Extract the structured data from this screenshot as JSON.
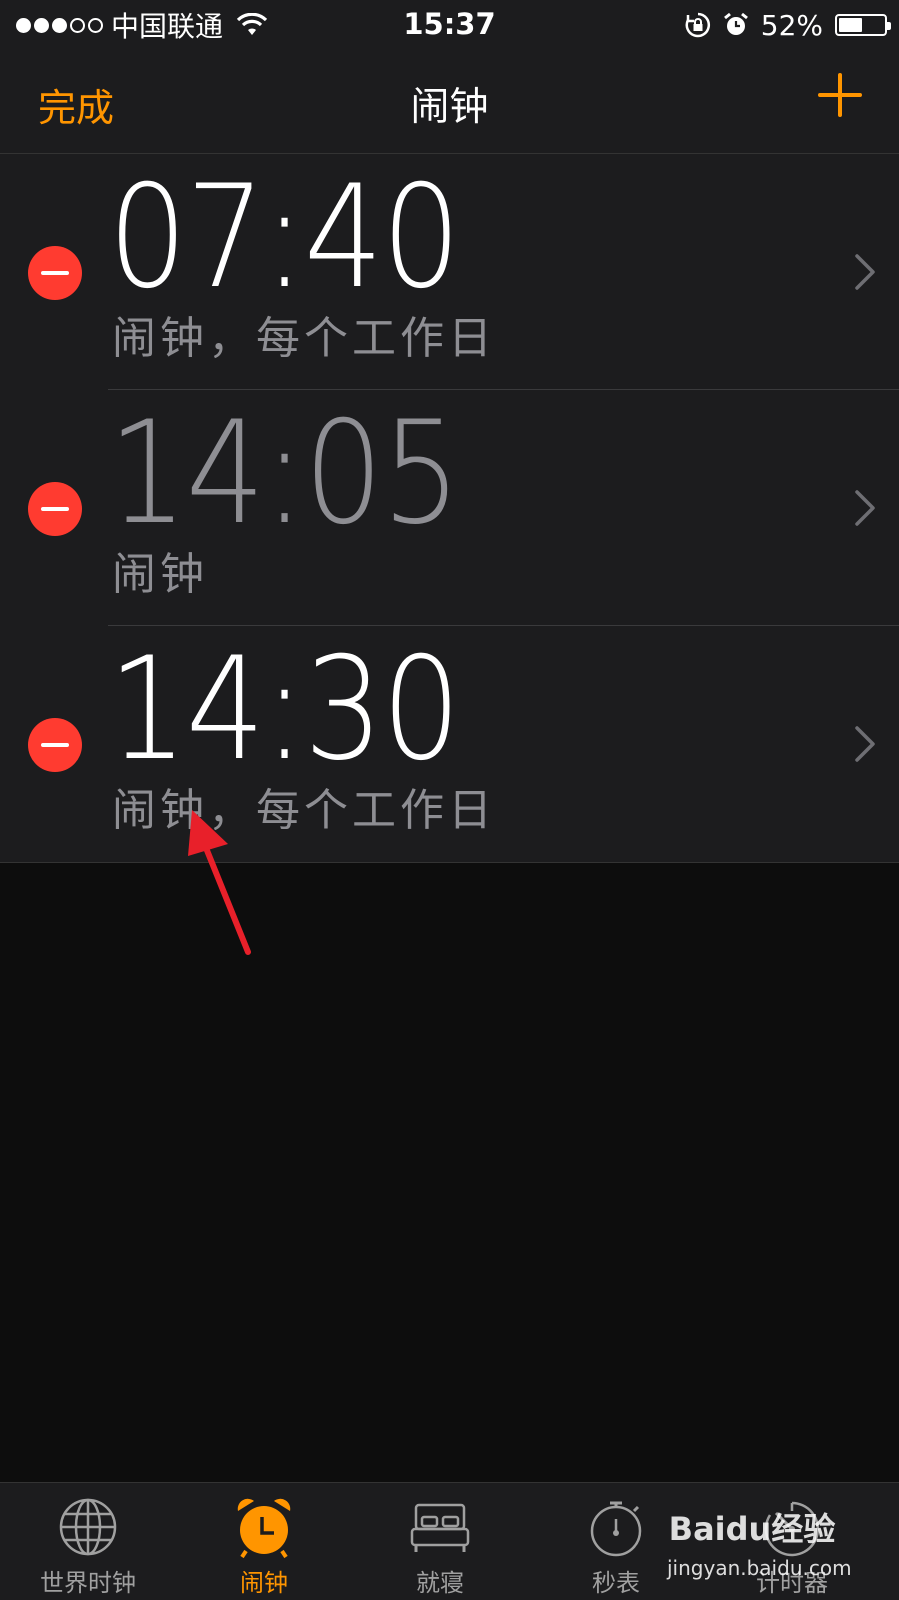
{
  "status_bar": {
    "signal_full": 3,
    "signal_total": 5,
    "carrier": "中国联通",
    "time": "15:37",
    "battery": "52%",
    "battery_level": 0.52
  },
  "nav": {
    "done_label": "完成",
    "title": "闹钟",
    "add_icon": "plus-icon"
  },
  "alarms": [
    {
      "time": "07:40",
      "label": "闹钟，每个工作日",
      "enabled": true
    },
    {
      "time": "14:05",
      "label": "闹钟",
      "enabled": false
    },
    {
      "time": "14:30",
      "label": "闹钟，每个工作日",
      "enabled": true
    }
  ],
  "tabs": [
    {
      "label": "世界时钟",
      "icon": "globe-icon",
      "active": false
    },
    {
      "label": "闹钟",
      "icon": "alarm-clock-icon",
      "active": true
    },
    {
      "label": "就寝",
      "icon": "bed-icon",
      "active": false
    },
    {
      "label": "秒表",
      "icon": "stopwatch-icon",
      "active": false
    },
    {
      "label": "计时器",
      "icon": "timer-icon",
      "active": false
    }
  ],
  "watermark": {
    "logo": "Baidu经验",
    "url": "jingyan.baidu.com"
  },
  "colors": {
    "accent": "#ff9500",
    "delete": "#ff3b30",
    "annotation": "#e8202a"
  }
}
